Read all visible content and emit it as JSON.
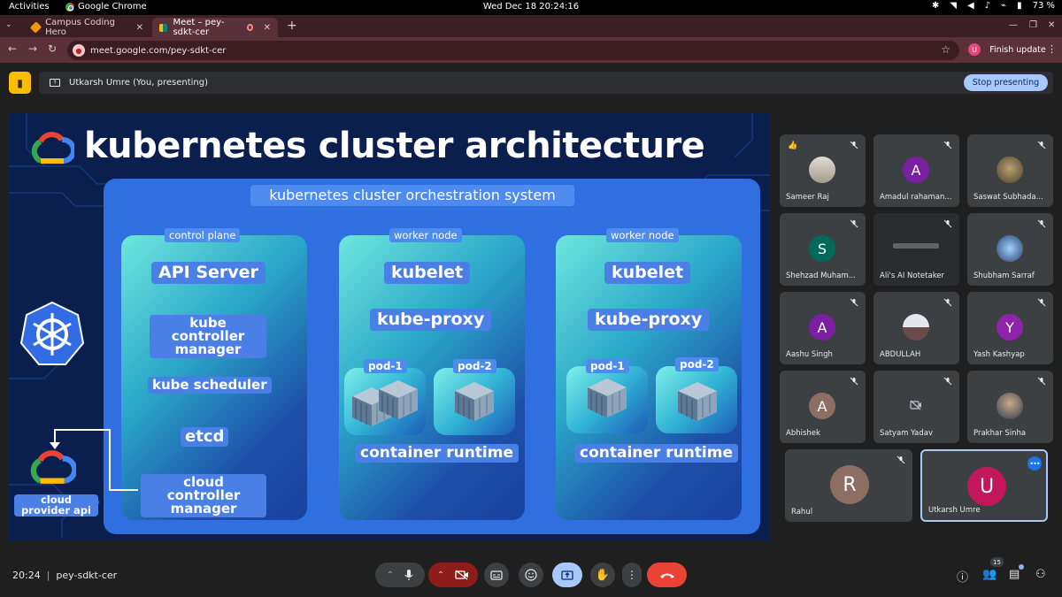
{
  "os": {
    "activities": "Activities",
    "app_name": "Google Chrome",
    "clock": "Wed Dec 18  20:24:16",
    "battery": "73 %"
  },
  "browser": {
    "tabs": [
      {
        "title": "Campus Coding Hero",
        "active": false
      },
      {
        "title": "Meet – pey-sdkt-cer",
        "active": true
      }
    ],
    "url": "meet.google.com/pey-sdkt-cer",
    "profile_initial": "U",
    "finish_update": "Finish update"
  },
  "presenting": {
    "text": "Utkarsh Umre (You, presenting)",
    "stop_label": "Stop presenting"
  },
  "slide": {
    "title": "kubernetes cluster architecture",
    "orchestrator_label": "kubernetes cluster orchestration system",
    "control_plane": {
      "label": "control plane",
      "components": [
        "API Server",
        "kube controller manager",
        "kube scheduler",
        "etcd",
        "cloud controller manager"
      ]
    },
    "worker_nodes": [
      {
        "label": "worker node",
        "kubelet": "kubelet",
        "proxy": "kube-proxy",
        "pods": [
          "pod-1",
          "pod-2"
        ],
        "runtime": "container runtime"
      },
      {
        "label": "worker node",
        "kubelet": "kubelet",
        "proxy": "kube-proxy",
        "pods": [
          "pod-1",
          "pod-2"
        ],
        "runtime": "container runtime"
      }
    ],
    "cloud_provider": "cloud provider api"
  },
  "participants": [
    {
      "name": "Sameer Raj",
      "type": "photo",
      "hand": true
    },
    {
      "name": "Amadul rahaman...",
      "type": "initial",
      "initial": "A",
      "color": "#7b1fa2"
    },
    {
      "name": "Saswat Subhada...",
      "type": "photo"
    },
    {
      "name": "Shehzad Muham...",
      "type": "initial",
      "initial": "S",
      "color": "#00695c"
    },
    {
      "name": "Ali's AI Notetaker",
      "type": "note"
    },
    {
      "name": "Shubham Sarraf",
      "type": "photo"
    },
    {
      "name": "Aashu Singh",
      "type": "initial",
      "initial": "A",
      "color": "#7b1fa2"
    },
    {
      "name": "ABDULLAH",
      "type": "photo"
    },
    {
      "name": "Yash Kashyap",
      "type": "initial",
      "initial": "Y",
      "color": "#8e24aa"
    },
    {
      "name": "Abhishek",
      "type": "initial",
      "initial": "A",
      "color": "#8d6e63"
    },
    {
      "name": "Satyam Yadav",
      "type": "cam-off"
    },
    {
      "name": "Prakhar Sinha",
      "type": "photo"
    },
    {
      "name": "Rahul",
      "type": "initial",
      "initial": "R",
      "color": "#8d6e63"
    },
    {
      "name": "Utkarsh Umre",
      "type": "initial",
      "initial": "U",
      "color": "#c2185b"
    }
  ],
  "meeting": {
    "time": "20:24",
    "code": "pey-sdkt-cer",
    "participant_count": "15"
  },
  "colors": {
    "accent": "#a8c7fa",
    "end_call": "#ea4335",
    "present_badge": "#fbbc04"
  }
}
